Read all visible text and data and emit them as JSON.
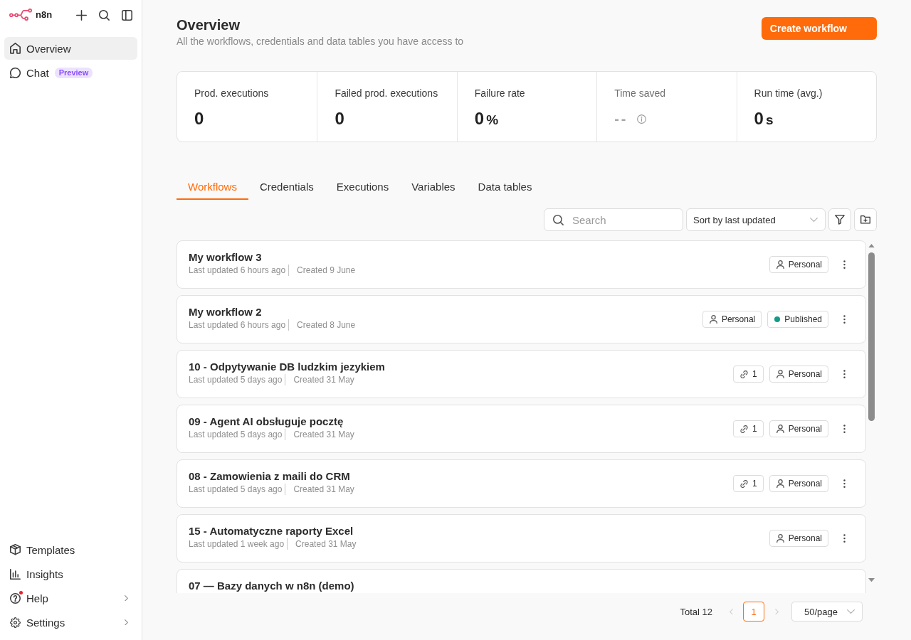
{
  "sidebar": {
    "logo": {
      "text": "n8n"
    },
    "nav": [
      {
        "label": "Overview",
        "selected": true
      },
      {
        "label": "Chat",
        "selected": false,
        "badge": "Preview"
      }
    ],
    "footer_nav": [
      {
        "label": "Templates",
        "submenu": false,
        "notification": false
      },
      {
        "label": "Insights",
        "submenu": false,
        "notification": false
      },
      {
        "label": "Help",
        "submenu": true,
        "notification": true
      },
      {
        "label": "Settings",
        "submenu": true,
        "notification": false
      }
    ]
  },
  "header": {
    "title": "Overview",
    "subtitle": "All the workflows, credentials and data tables you have access to",
    "primary_button": "Create workflow"
  },
  "stats": [
    {
      "label": "Prod. executions",
      "value": "0",
      "disabled": false
    },
    {
      "label": "Failed prod. executions",
      "value": "0",
      "disabled": false
    },
    {
      "label": "Failure rate",
      "value": "0",
      "unit": "%",
      "disabled": false
    },
    {
      "label": "Time saved",
      "value": "--",
      "disabled": true
    },
    {
      "label": "Run time (avg.)",
      "value": "0",
      "unit": "s",
      "disabled": false
    }
  ],
  "tabs": [
    {
      "label": "Workflows",
      "selected": true
    },
    {
      "label": "Credentials",
      "selected": false
    },
    {
      "label": "Executions",
      "selected": false
    },
    {
      "label": "Variables",
      "selected": false
    },
    {
      "label": "Data tables",
      "selected": false
    }
  ],
  "toolbar": {
    "search": {
      "placeholder": "Search"
    },
    "sort": {
      "value": "Sort by last updated"
    }
  },
  "workflows": [
    {
      "title": "My workflow 3",
      "updated": "Last updated 6 hours ago",
      "created": "Created 9 June",
      "badges": [
        {
          "kind": "project",
          "text": "Personal"
        }
      ]
    },
    {
      "title": "My workflow 2",
      "updated": "Last updated 6 hours ago",
      "created": "Created 8 June",
      "badges": [
        {
          "kind": "project",
          "text": "Personal"
        },
        {
          "kind": "status",
          "text": "Published",
          "color": "#149a8b"
        }
      ]
    },
    {
      "title": "10 - Odpytywanie DB ludzkim jezykiem",
      "updated": "Last updated 5 days ago",
      "created": "Created 31 May",
      "badges": [
        {
          "kind": "shared",
          "text": "1"
        },
        {
          "kind": "project",
          "text": "Personal"
        }
      ]
    },
    {
      "title": "09 - Agent AI obsługuje pocztę",
      "updated": "Last updated 5 days ago",
      "created": "Created 31 May",
      "badges": [
        {
          "kind": "shared",
          "text": "1"
        },
        {
          "kind": "project",
          "text": "Personal"
        }
      ]
    },
    {
      "title": "08 - Zamowienia z maili do CRM",
      "updated": "Last updated 5 days ago",
      "created": "Created 31 May",
      "badges": [
        {
          "kind": "shared",
          "text": "1"
        },
        {
          "kind": "project",
          "text": "Personal"
        }
      ]
    },
    {
      "title": "15 - Automatyczne raporty Excel",
      "updated": "Last updated 1 week ago",
      "created": "Created 31 May",
      "badges": [
        {
          "kind": "project",
          "text": "Personal"
        }
      ]
    },
    {
      "title": "07 — Bazy danych w n8n (demo)"
    }
  ],
  "pagination": {
    "total": "Total 12",
    "prev": {
      "disabled": true
    },
    "pages": [
      {
        "label": "1",
        "selected": true
      }
    ],
    "next": {
      "disabled": true
    },
    "page_size": "50/page"
  }
}
